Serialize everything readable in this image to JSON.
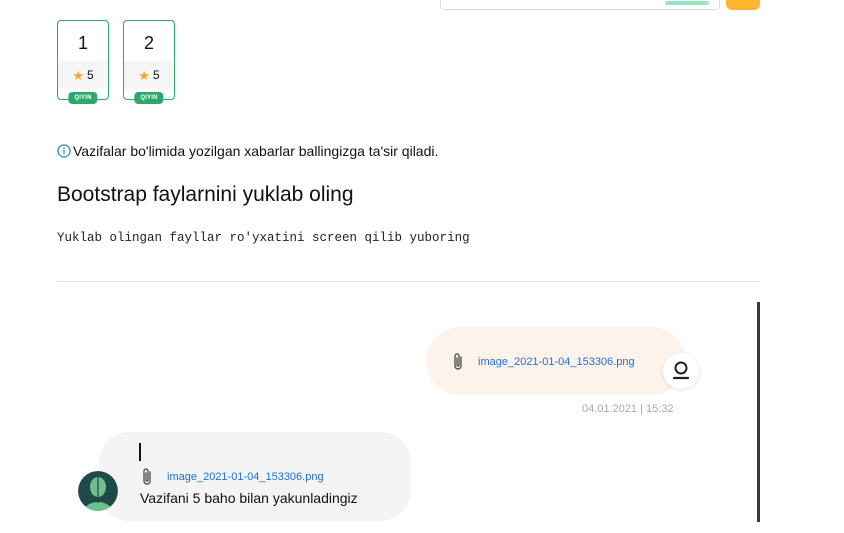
{
  "tasks": [
    {
      "number": "1",
      "points": "5",
      "level": "QIYIN"
    },
    {
      "number": "2",
      "points": "5",
      "level": "QIYIN"
    }
  ],
  "info_text": "Vazifalar bo'limida yozilgan xabarlar ballingizga ta'sir qiladi.",
  "task": {
    "title": "Bootstrap faylarnini yuklab oling",
    "description": "Yuklab olingan fayllar ro'yxatini screen qilib yuboring"
  },
  "chat": {
    "outgoing": {
      "attachment": "image_2021-01-04_153306.png",
      "timestamp": "04.01.2021 | 15:32"
    },
    "incoming": {
      "attachment": "image_2021-01-04_153306.png",
      "message": "Vazifani 5 baho bilan yakunladingiz"
    }
  },
  "colors": {
    "accent_green": "#2ca86b",
    "star": "#f5a623",
    "link": "#1e6fd9",
    "button": "#ffb52e"
  }
}
